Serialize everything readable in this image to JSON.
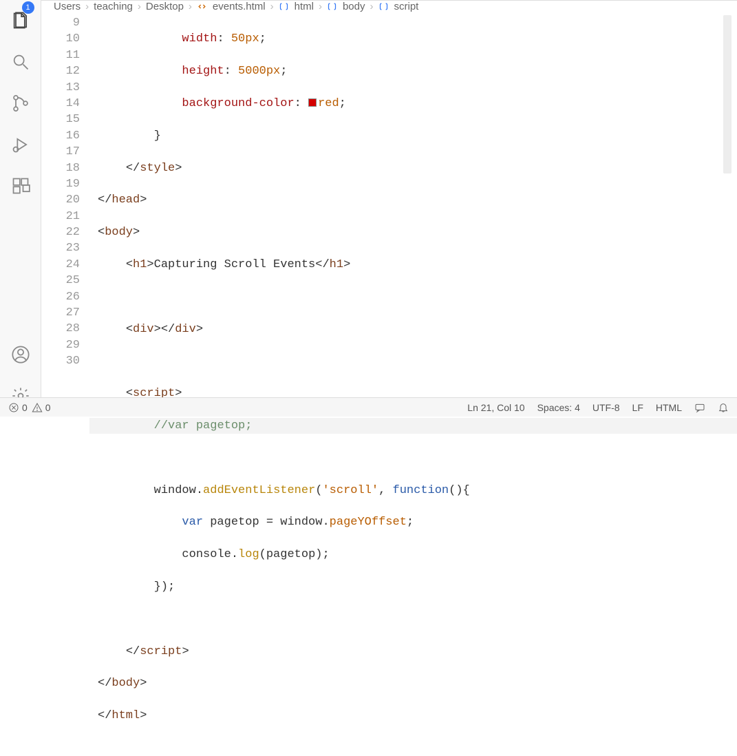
{
  "activity_badge": "1",
  "breadcrumb": {
    "p0": "Users",
    "p1": "teaching",
    "p2": "Desktop",
    "p3": "events.html",
    "p4": "html",
    "p5": "body",
    "p6": "script"
  },
  "lines": {
    "n9": "9",
    "n10": "10",
    "n11": "11",
    "n12": "12",
    "n13": "13",
    "n14": "14",
    "n15": "15",
    "n16": "16",
    "n17": "17",
    "n18": "18",
    "n19": "19",
    "n20": "20",
    "n21": "21",
    "n22": "22",
    "n23": "23",
    "n24": "24",
    "n25": "25",
    "n26": "26",
    "n27": "27",
    "n28": "28",
    "n29": "29",
    "n30": "30"
  },
  "code": {
    "l9a": "width",
    "l9b": ": ",
    "l9c": "50px",
    "l9d": ";",
    "l10a": "height",
    "l10b": ": ",
    "l10c": "5000px",
    "l10d": ";",
    "l11a": "background-color",
    "l11b": ": ",
    "l11c": "red",
    "l11d": ";",
    "l12": "}",
    "l13a": "</",
    "l13b": "style",
    "l13c": ">",
    "l14a": "</",
    "l14b": "head",
    "l14c": ">",
    "l15a": "<",
    "l15b": "body",
    "l15c": ">",
    "l16a": "<",
    "l16b": "h1",
    "l16c": ">",
    "l16d": "Capturing Scroll Events",
    "l16e": "</",
    "l16f": "h1",
    "l16g": ">",
    "l18a": "<",
    "l18b": "div",
    "l18c": "></",
    "l18d": "div",
    "l18e": ">",
    "l20a": "<",
    "l20b": "script",
    "l20c": ">",
    "l21": "//var pagetop;",
    "l23a": "window.",
    "l23b": "addEventListener",
    "l23c": "(",
    "l23d": "'scroll'",
    "l23e": ", ",
    "l23f": "function",
    "l23g": "(){",
    "l24a": "var",
    "l24b": " pagetop = window.",
    "l24c": "pageYOffset",
    "l24d": ";",
    "l25a": "console.",
    "l25b": "log",
    "l25c": "(pagetop);",
    "l26": "});",
    "l28a": "</",
    "l28b": "script",
    "l28c": ">",
    "l29a": "</",
    "l29b": "body",
    "l29c": ">",
    "l30a": "</",
    "l30b": "html",
    "l30c": ">"
  },
  "color_swatch": "#d40000",
  "status": {
    "errors": "0",
    "warnings": "0",
    "lncol": "Ln 21, Col 10",
    "spaces": "Spaces: 4",
    "encoding": "UTF-8",
    "eol": "LF",
    "lang": "HTML"
  }
}
